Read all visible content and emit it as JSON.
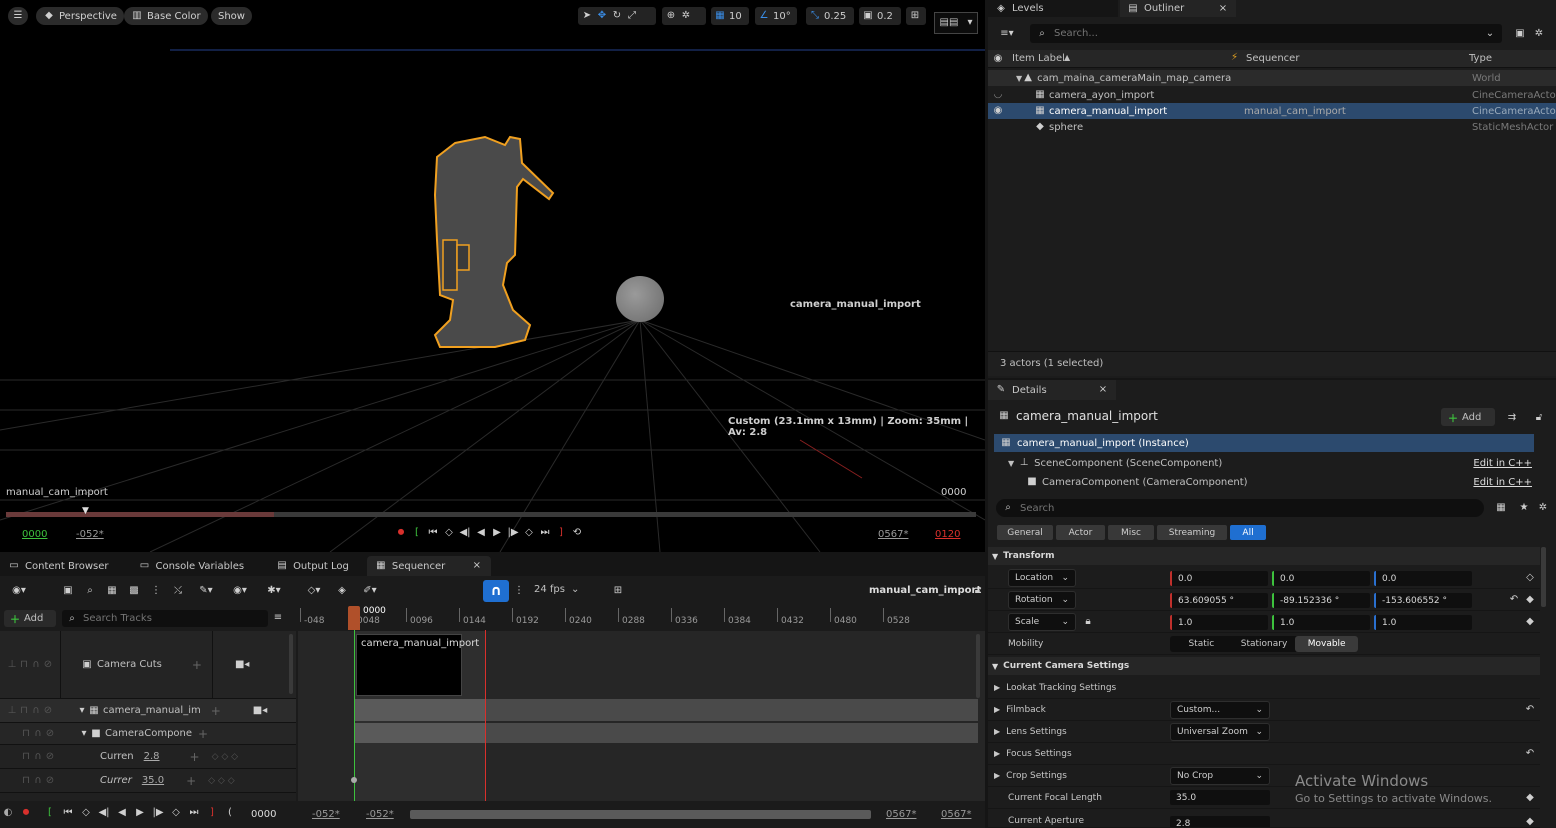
{
  "viewport": {
    "perspective_label": "Perspective",
    "view_mode_label": "Base Color",
    "show_label": "Show",
    "grid_snap": "10",
    "rotation_snap": "10°",
    "scale_snap": "0.25",
    "camera_speed": "0.2",
    "actor_label": "camera_manual_import",
    "camera_info": "Custom (23.1mm x 13mm) | Zoom: 35mm | Av: 2.8",
    "bottom_left_label": "manual_cam_import",
    "bottom_right_frame": "0000",
    "range_start": "0000",
    "range_start_neg": "-052*",
    "range_end": "0567*",
    "range_end_red": "0120"
  },
  "bottom_tabs": {
    "content_browser": "Content Browser",
    "console_variables": "Console Variables",
    "output_log": "Output Log",
    "sequencer": "Sequencer"
  },
  "sequencer": {
    "add_label": "Add",
    "search_placeholder": "Search Tracks",
    "fps": "24 fps",
    "sequence_name": "manual_cam_import",
    "playhead": "0000",
    "ruler": [
      "-048",
      "0048",
      "0096",
      "0144",
      "0192",
      "0240",
      "0288",
      "0336",
      "0384",
      "0432",
      "0480",
      "0528"
    ],
    "tracks": {
      "camera_cuts": "Camera Cuts",
      "camera_actor": "camera_manual_im",
      "camera_component": "CameraCompone",
      "prop1_name": "Curren",
      "prop1_value": "2.8",
      "prop2_name": "Currer",
      "prop2_value": "35.0"
    },
    "section_label": "camera_manual_import",
    "footer": {
      "current_frame": "0000",
      "start_a": "-052*",
      "start_b": "-052*",
      "end_a": "0567*",
      "end_b": "0567*"
    }
  },
  "outliner": {
    "levels_tab": "Levels",
    "outliner_tab": "Outliner",
    "search_placeholder": "Search...",
    "col_label": "Item Label",
    "col_sequencer": "Sequencer",
    "col_type": "Type",
    "rows": [
      {
        "label": "cam_maina_cameraMain_map_camera",
        "sequencer": "",
        "type": "World"
      },
      {
        "label": "camera_ayon_import",
        "sequencer": "",
        "type": "CineCameraActor"
      },
      {
        "label": "camera_manual_import",
        "sequencer": "manual_cam_import",
        "type": "CineCameraActor"
      },
      {
        "label": "sphere",
        "sequencer": "",
        "type": "StaticMeshActor"
      }
    ],
    "status": "3 actors (1 selected)"
  },
  "details": {
    "tab": "Details",
    "object_name": "camera_manual_import",
    "add_label": "Add",
    "instance": "camera_manual_import (Instance)",
    "scene_component": "SceneComponent (SceneComponent)",
    "camera_component": "CameraComponent (CameraComponent)",
    "edit_cpp": "Edit in C++",
    "search_placeholder": "Search",
    "filters": [
      "General",
      "Actor",
      "Misc",
      "Streaming",
      "All"
    ],
    "transform_section": "Transform",
    "location_label": "Location",
    "location": [
      "0.0",
      "0.0",
      "0.0"
    ],
    "rotation_label": "Rotation",
    "rotation": [
      "63.609055 °",
      "-89.152336 °",
      "-153.606552 °"
    ],
    "scale_label": "Scale",
    "scale": [
      "1.0",
      "1.0",
      "1.0"
    ],
    "mobility_label": "Mobility",
    "mobility_options": [
      "Static",
      "Stationary",
      "Movable"
    ],
    "camera_section": "Current Camera Settings",
    "lookat": "Lookat Tracking Settings",
    "filmback": "Filmback",
    "filmback_value": "Custom...",
    "lens": "Lens Settings",
    "lens_value": "Universal Zoom",
    "focus": "Focus Settings",
    "crop": "Crop Settings",
    "crop_value": "No Crop",
    "focal_length_label": "Current Focal Length",
    "focal_length": "35.0",
    "aperture_label": "Current Aperture",
    "aperture": "2.8"
  },
  "watermark": {
    "title": "Activate Windows",
    "subtitle": "Go to Settings to activate Windows."
  },
  "colors": {
    "accent": "#1f6fd1",
    "selection": "#2c4a6e",
    "outline": "#f0a020",
    "record": "#d9302c"
  }
}
